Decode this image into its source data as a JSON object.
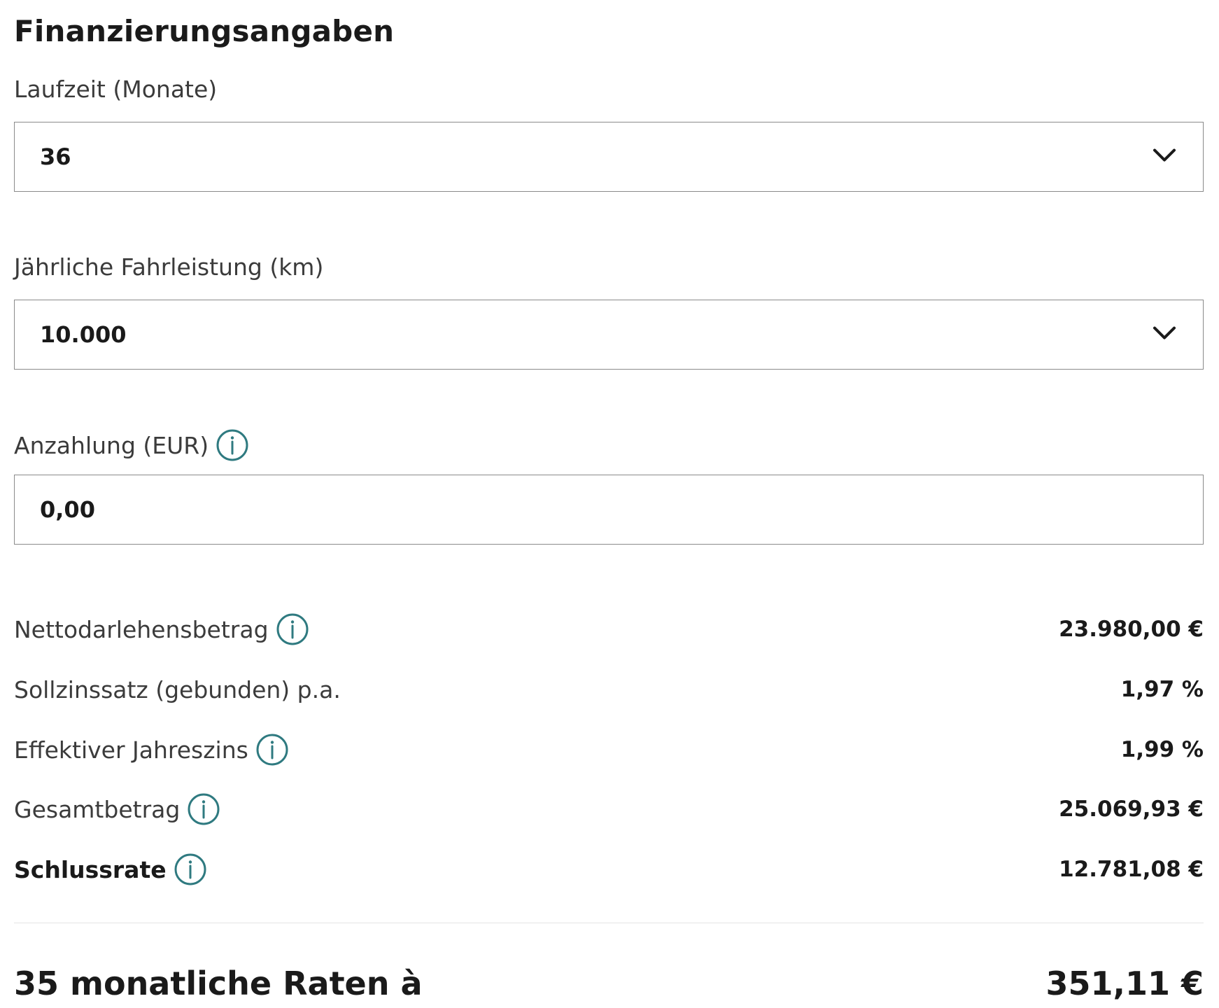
{
  "section": {
    "title": "Finanzierungsangaben"
  },
  "fields": {
    "laufzeit": {
      "label": "Laufzeit (Monate)",
      "value": "36"
    },
    "fahrleistung": {
      "label": "Jährliche Fahrleistung (km)",
      "value": "10.000"
    },
    "anzahlung": {
      "label": "Anzahlung (EUR)",
      "value": "0,00"
    }
  },
  "summary": [
    {
      "label": "Nettodarlehensbetrag",
      "value": "23.980,00 €",
      "info": true,
      "bold": false
    },
    {
      "label": "Sollzinssatz (gebunden) p.a.",
      "value": "1,97 %",
      "info": false,
      "bold": false
    },
    {
      "label": "Effektiver Jahreszins",
      "value": "1,99 %",
      "info": true,
      "bold": false
    },
    {
      "label": "Gesamtbetrag",
      "value": "25.069,93 €",
      "info": true,
      "bold": false
    },
    {
      "label": "Schlussrate",
      "value": "12.781,08 €",
      "info": true,
      "bold": true
    }
  ],
  "total": {
    "label": "35 monatliche Raten à",
    "value": "351,11 €"
  },
  "colors": {
    "info_icon": "#2f7a80",
    "border": "#8a8a8a",
    "divider": "#e4e4e4"
  },
  "icons": {
    "dropdown": "chevron-down-icon",
    "info": "info-icon"
  }
}
